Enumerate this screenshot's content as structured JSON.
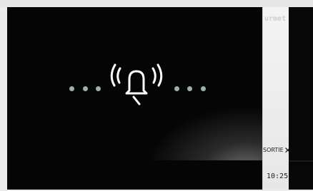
{
  "brand": {
    "name": "urmet"
  },
  "exit_button": {
    "label": "SORTIE",
    "icon": "x-icon"
  },
  "clock": {
    "time": "10:25"
  },
  "call_indicator": {
    "icon": "ringing-bell-icon",
    "dot_count_left": 3,
    "dot_count_right": 3,
    "dot_color": "#9fb0a8",
    "bell_color": "#ffffff"
  },
  "colors": {
    "screen": "#050505",
    "side_panel": "#ececec"
  }
}
